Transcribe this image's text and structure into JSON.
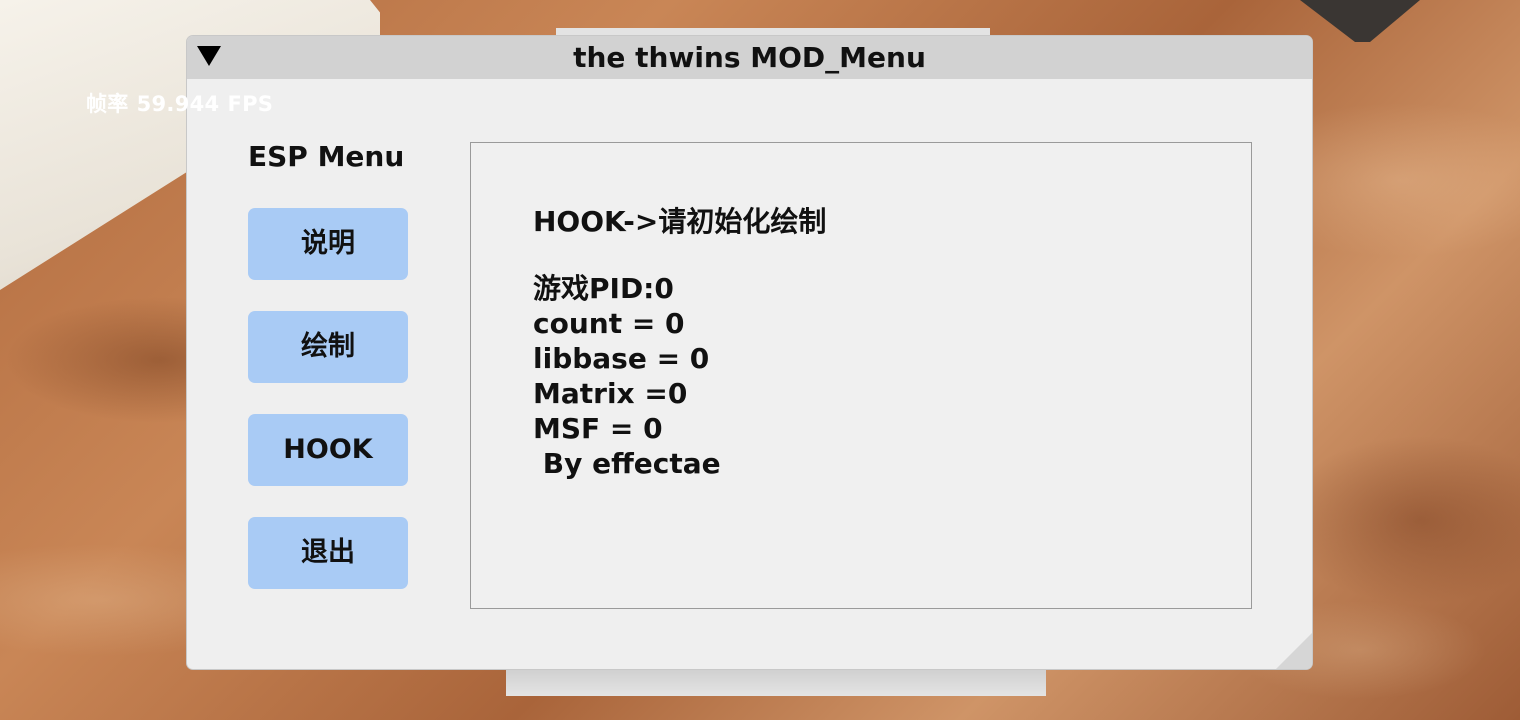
{
  "fps": {
    "label": "帧率",
    "value": "59.944",
    "unit": "FPS"
  },
  "window": {
    "title": "the thwins MOD_Menu"
  },
  "sidebar": {
    "heading": "ESP Menu",
    "buttons": [
      {
        "label": "说明"
      },
      {
        "label": "绘制"
      },
      {
        "label": "HOOK"
      },
      {
        "label": "退出"
      }
    ]
  },
  "content": {
    "status": "HOOK->请初始化绘制",
    "lines": [
      "游戏PID:0",
      "count = 0",
      "libbase = 0",
      "Matrix =0",
      "MSF = 0",
      " By effectae"
    ]
  },
  "colors": {
    "button_bg": "#a9cbf5",
    "window_bg": "#efefef",
    "titlebar_bg": "#d2d2d2"
  },
  "icons": {
    "collapse": "triangle-down-icon",
    "resize": "resize-grip-icon"
  }
}
